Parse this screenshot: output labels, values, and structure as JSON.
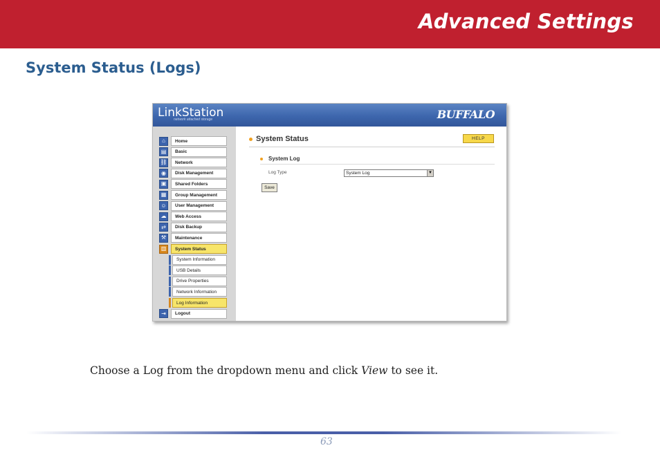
{
  "banner": {
    "title": "Advanced Settings"
  },
  "section": {
    "title": "System Status (Logs)"
  },
  "app": {
    "logo": "LinkStation",
    "logo_sub": "network attached storage",
    "brand": "BUFFALO",
    "nav": [
      {
        "label": "Home",
        "icon": "house-icon",
        "glyph": "⌂"
      },
      {
        "label": "Basic",
        "icon": "basic-settings-icon",
        "glyph": "▤"
      },
      {
        "label": "Network",
        "icon": "network-icon",
        "glyph": "⛓"
      },
      {
        "label": "Disk Management",
        "icon": "disk-icon",
        "glyph": "◉"
      },
      {
        "label": "Shared Folders",
        "icon": "shared-folder-icon",
        "glyph": "▣"
      },
      {
        "label": "Group Management",
        "icon": "group-icon",
        "glyph": "▦"
      },
      {
        "label": "User Management",
        "icon": "user-icon",
        "glyph": "☺"
      },
      {
        "label": "Web Access",
        "icon": "web-access-icon",
        "glyph": "☁"
      },
      {
        "label": "Disk Backup",
        "icon": "backup-icon",
        "glyph": "⇄"
      },
      {
        "label": "Maintenance",
        "icon": "maintenance-icon",
        "glyph": "⚒"
      },
      {
        "label": "System Status",
        "icon": "system-status-icon",
        "glyph": "▥",
        "active": true
      }
    ],
    "sub_nav": [
      {
        "label": "System Information"
      },
      {
        "label": "USB Details"
      },
      {
        "label": "Drive Properties"
      },
      {
        "label": "Network Information"
      },
      {
        "label": "Log Information",
        "active": true
      }
    ],
    "logout": {
      "label": "Logout",
      "icon": "logout-icon",
      "glyph": "⇥"
    },
    "content": {
      "title": "System Status",
      "help_label": "HELP",
      "subsection_title": "System Log",
      "log_type_label": "Log Type",
      "log_type_value": "System Log",
      "save_label": "Save"
    }
  },
  "caption": {
    "before": "Choose a Log from the dropdown menu and click ",
    "emphasis": "View",
    "after": " to see it."
  },
  "footer": {
    "page_number": "63"
  },
  "colors": {
    "banner": "#c0202f",
    "section_title": "#2b5d8f",
    "app_header": "#3d66ad",
    "active_nav": "#f7e56a"
  }
}
